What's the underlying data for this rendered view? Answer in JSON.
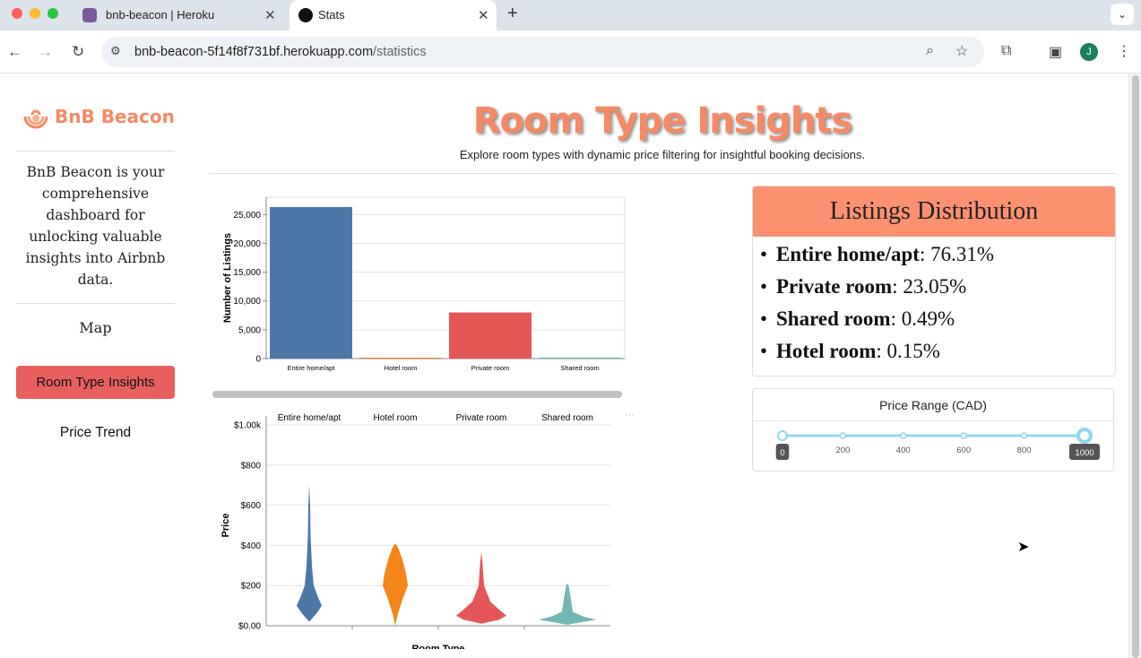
{
  "browser": {
    "tabs": [
      {
        "title": "bnb-beacon | Heroku",
        "active": false
      },
      {
        "title": "Stats",
        "active": true
      }
    ],
    "url_host": "bnb-beacon-5f14f8f731bf.herokuapp.com",
    "url_path": "/statistics",
    "profile_initial": "J"
  },
  "sidebar": {
    "logo_text": "BnB Beacon",
    "about": "BnB Beacon is your comprehensive dashboard for unlocking valuable insights into Airbnb data.",
    "nav": {
      "map": "Map",
      "room_type": "Room Type Insights",
      "price_trend": "Price Trend"
    }
  },
  "main": {
    "title": "Room Type Insights",
    "subtitle": "Explore room types with dynamic price filtering for insightful booking decisions."
  },
  "distribution": {
    "heading": "Listings Distribution",
    "items": [
      {
        "label": "Entire home/apt",
        "value": "76.31%"
      },
      {
        "label": "Private room",
        "value": "23.05%"
      },
      {
        "label": "Shared room",
        "value": "0.49%"
      },
      {
        "label": "Hotel room",
        "value": "0.15%"
      }
    ]
  },
  "price_filter": {
    "label": "Price Range (CAD)",
    "min": 0,
    "max": 1000,
    "ticks": [
      "0",
      "200",
      "400",
      "600",
      "800",
      "1000"
    ],
    "selected_min": "0",
    "selected_max": "1000"
  },
  "colors": {
    "accent": "#f58a64",
    "nav_active": "#e8605e",
    "header": "#fb9170"
  },
  "chart_data": [
    {
      "type": "bar",
      "categories": [
        "Entire home/apt",
        "Hotel room",
        "Private room",
        "Shared room"
      ],
      "values": [
        26300,
        50,
        8000,
        170
      ],
      "colors": [
        "#4c78a8",
        "#f58518",
        "#e45756",
        "#72b7b2"
      ],
      "ylabel": "Number of Listings",
      "xlabel": "",
      "ylim": [
        0,
        28000
      ],
      "yticks": [
        "0",
        "5,000",
        "10,000",
        "15,000",
        "20,000",
        "25,000"
      ],
      "ytick_values": [
        0,
        5000,
        10000,
        15000,
        20000,
        25000
      ]
    },
    {
      "type": "violin",
      "categories": [
        "Entire home/apt",
        "Hotel room",
        "Private room",
        "Shared room"
      ],
      "colors": [
        "#4c78a8",
        "#f58518",
        "#e45756",
        "#72b7b2"
      ],
      "ylabel": "Price",
      "xlabel": "Room Type",
      "ylim": [
        0,
        1000
      ],
      "yticks": [
        "$0.00",
        "$200",
        "$400",
        "$600",
        "$800",
        "$1.00k"
      ],
      "ytick_values": [
        0,
        200,
        400,
        600,
        800,
        1000
      ]
    }
  ]
}
